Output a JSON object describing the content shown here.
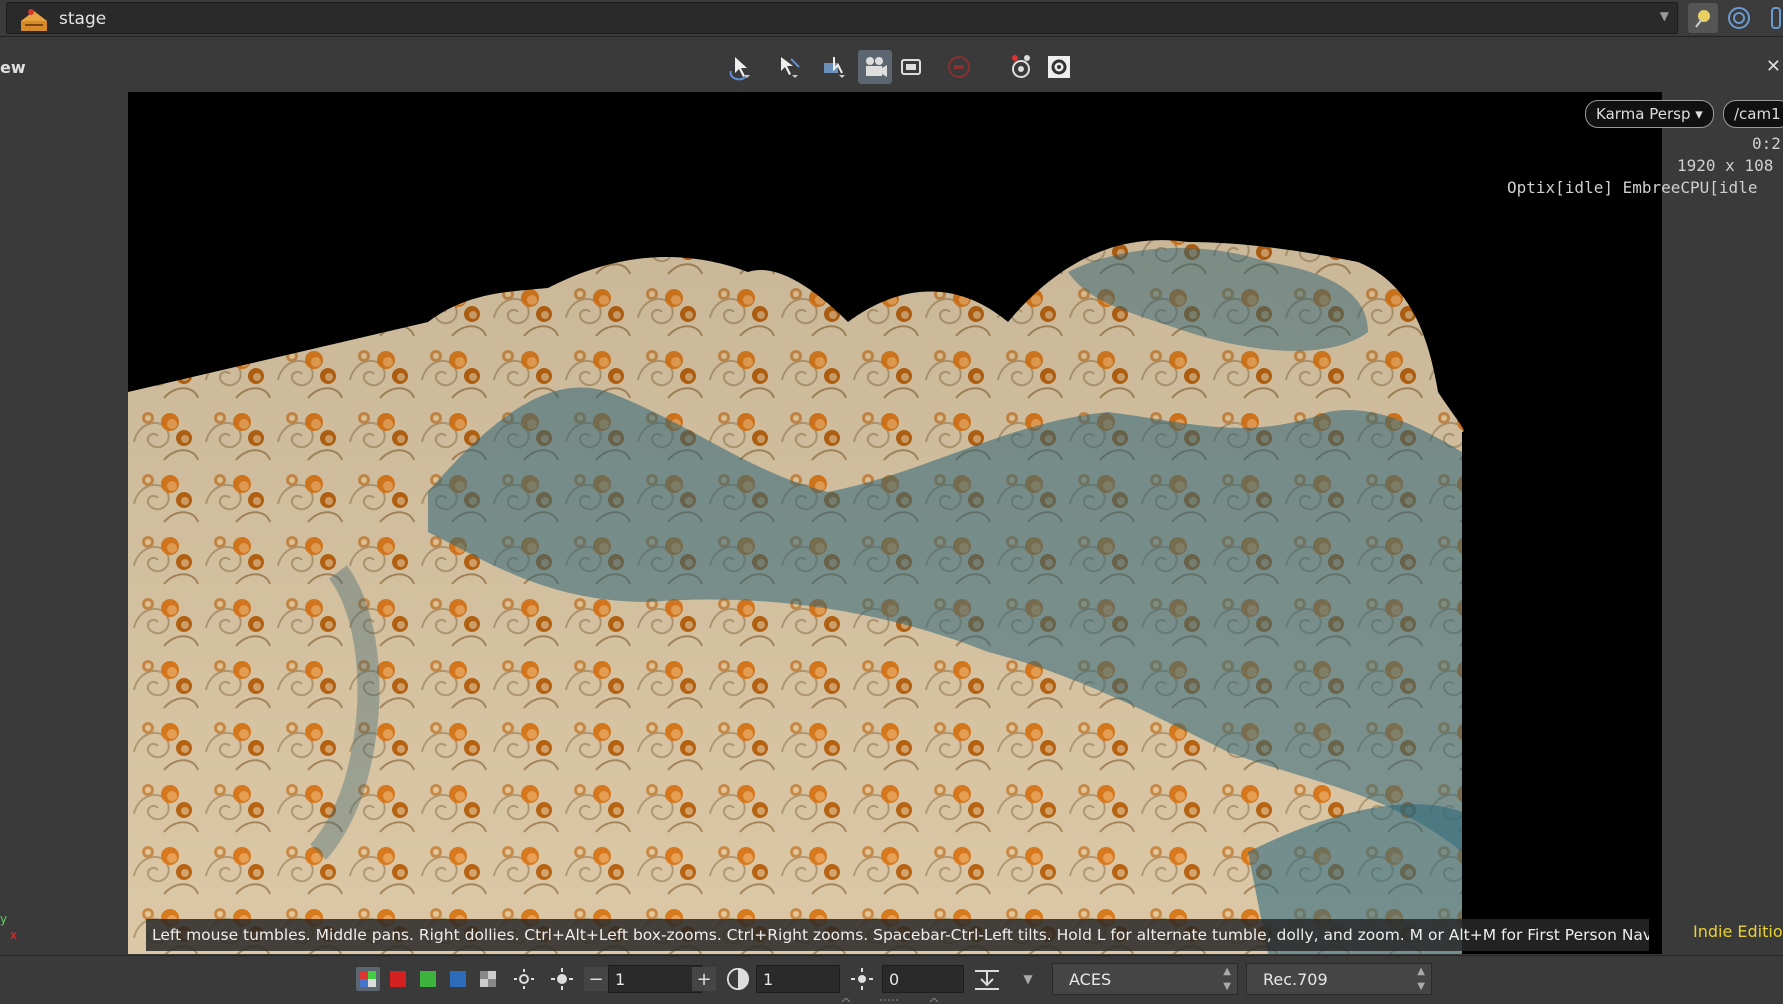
{
  "header": {
    "path": "stage"
  },
  "toolbar": {
    "pane_label": "ew",
    "close_glyph": "✕"
  },
  "viewport": {
    "renderer": "Karma Persp",
    "camera": "/cam1",
    "time": "0:2",
    "resolution": "1920 x 108",
    "render_status": "Optix[idle] EmbreeCPU[idle",
    "axis_y": "y",
    "axis_x": "x",
    "help_text": "Left mouse tumbles. Middle pans. Right dollies. Ctrl+Alt+Left box-zooms. Ctrl+Right zooms. Spacebar-Ctrl-Left tilts. Hold L for alternate tumble, dolly, and zoom.    M or Alt+M for First Person Navigation.",
    "edition": "Indie Edition"
  },
  "bottom": {
    "minus": "−",
    "plus": "+",
    "exposure": "1",
    "gamma": "1",
    "offset": "0",
    "color_space": "ACES",
    "display": "Rec.709"
  },
  "colors": {
    "fabric_base": "#dcc8a6",
    "pattern_orange": "#d97a1e",
    "shadow_teal": "#3e6a78",
    "edition_yellow": "#e8d230"
  }
}
